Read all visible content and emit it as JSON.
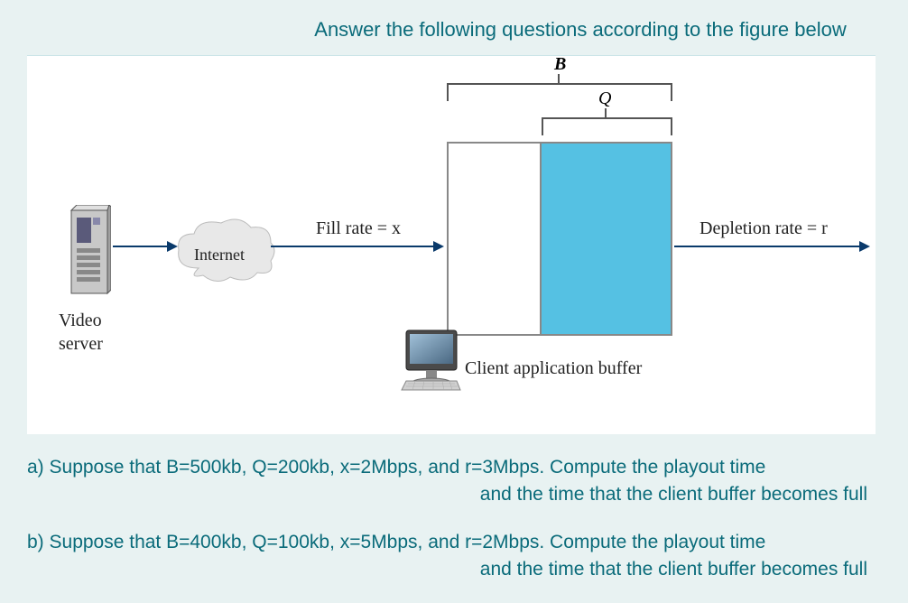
{
  "title": "Answer the following questions according to the figure below",
  "figure": {
    "server_label": "Video\nserver",
    "cloud_label": "Internet",
    "fill_rate_label": "Fill rate = x",
    "depletion_label": "Depletion rate = r",
    "buffer_label": "Client application buffer",
    "b_label": "B",
    "q_label": "Q"
  },
  "questions": {
    "a_line1": "a) Suppose that B=500kb, Q=200kb, x=2Mbps, and r=3Mbps. Compute the playout time",
    "a_line2": "and the time that the client buffer becomes full",
    "b_line1": "b) Suppose that B=400kb, Q=100kb, x=5Mbps, and r=2Mbps. Compute the playout time",
    "b_line2": "and the time that the client buffer becomes full"
  }
}
